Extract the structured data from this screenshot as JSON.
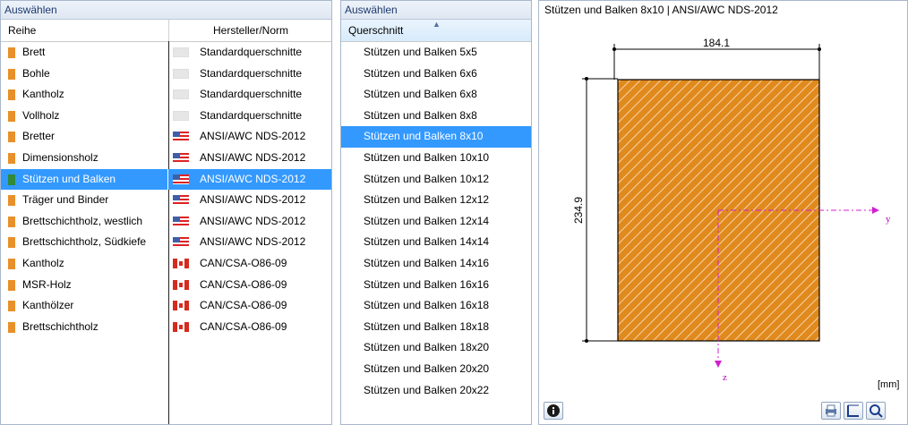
{
  "left_panel": {
    "header": "Auswählen",
    "columns": {
      "reihe": "Reihe",
      "hersteller": "Hersteller/Norm"
    },
    "rows": [
      {
        "reihe": "Brett",
        "swatch": "#e8902a",
        "flag": "none",
        "norm": "Standardquerschnitte"
      },
      {
        "reihe": "Bohle",
        "swatch": "#e8902a",
        "flag": "none",
        "norm": "Standardquerschnitte"
      },
      {
        "reihe": "Kantholz",
        "swatch": "#e8902a",
        "flag": "none",
        "norm": "Standardquerschnitte"
      },
      {
        "reihe": "Vollholz",
        "swatch": "#e8902a",
        "flag": "none",
        "norm": "Standardquerschnitte"
      },
      {
        "reihe": "Bretter",
        "swatch": "#e8902a",
        "flag": "us",
        "norm": "ANSI/AWC NDS-2012"
      },
      {
        "reihe": "Dimensionsholz",
        "swatch": "#e8902a",
        "flag": "us",
        "norm": "ANSI/AWC NDS-2012"
      },
      {
        "reihe": "Stützen und Balken",
        "swatch": "#2f8a3c",
        "flag": "us",
        "norm": "ANSI/AWC NDS-2012",
        "selected": true
      },
      {
        "reihe": "Träger und Binder",
        "swatch": "#e8902a",
        "flag": "us",
        "norm": "ANSI/AWC NDS-2012"
      },
      {
        "reihe": "Brettschichtholz, westlich",
        "swatch": "#e8902a",
        "flag": "us",
        "norm": "ANSI/AWC NDS-2012"
      },
      {
        "reihe": "Brettschichtholz, Südkiefe",
        "swatch": "#e8902a",
        "flag": "us",
        "norm": "ANSI/AWC NDS-2012"
      },
      {
        "reihe": "Kantholz",
        "swatch": "#e8902a",
        "flag": "ca",
        "norm": "CAN/CSA-O86-09"
      },
      {
        "reihe": "MSR-Holz",
        "swatch": "#e8902a",
        "flag": "ca",
        "norm": "CAN/CSA-O86-09"
      },
      {
        "reihe": "Kanthölzer",
        "swatch": "#e8902a",
        "flag": "ca",
        "norm": "CAN/CSA-O86-09"
      },
      {
        "reihe": "Brettschichtholz",
        "swatch": "#e8902a",
        "flag": "ca",
        "norm": "CAN/CSA-O86-09"
      }
    ]
  },
  "middle_panel": {
    "header": "Auswählen",
    "column": "Querschnitt",
    "items": [
      "Stützen und Balken 5x5",
      "Stützen und Balken 6x6",
      "Stützen und Balken 6x8",
      "Stützen und Balken 8x8",
      "Stützen und Balken 8x10",
      "Stützen und Balken 10x10",
      "Stützen und Balken 10x12",
      "Stützen und Balken 12x12",
      "Stützen und Balken 12x14",
      "Stützen und Balken 14x14",
      "Stützen und Balken 14x16",
      "Stützen und Balken 16x16",
      "Stützen und Balken 16x18",
      "Stützen und Balken 18x18",
      "Stützen und Balken 18x20",
      "Stützen und Balken 20x20",
      "Stützen und Balken 20x22"
    ],
    "selected_index": 4
  },
  "preview": {
    "title": "Stützen und Balken 8x10 | ANSI/AWC NDS-2012",
    "width_label": "184.1",
    "height_label": "234.9",
    "axis_y": "y",
    "axis_z": "z",
    "unit": "[mm]",
    "fill_color": "#e08a1e",
    "axis_color": "#d020d0"
  }
}
